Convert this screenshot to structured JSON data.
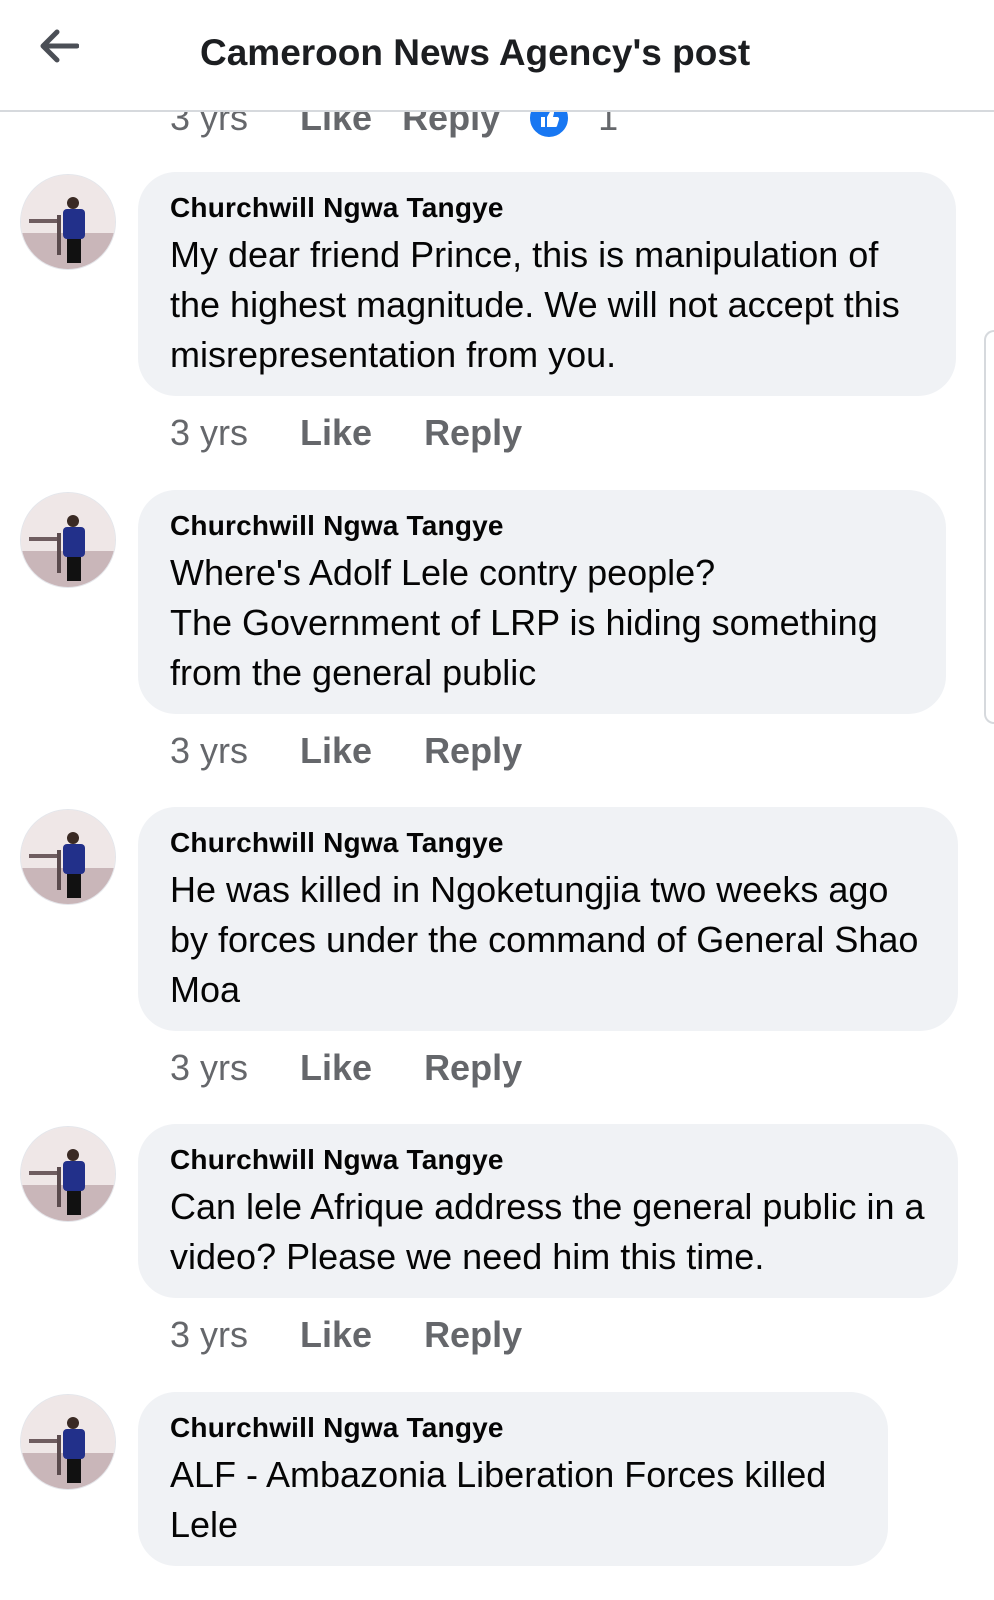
{
  "header": {
    "title": "Cameroon  News Agency's post",
    "back_icon": "arrow-left-icon"
  },
  "previous_comment_actions": {
    "time": "3 yrs",
    "like": "Like",
    "reply": "Reply",
    "reaction_icon": "like-reaction-icon",
    "reaction_count": "1"
  },
  "comments": [
    {
      "author": "Churchwill Ngwa Tangye",
      "text": "My dear friend Prince, this is manipulation of the highest magnitude. We will not accept this misrepresentation from you.",
      "time": "3 yrs",
      "like": "Like",
      "reply": "Reply"
    },
    {
      "author": "Churchwill Ngwa Tangye",
      "text": "Where's  Adolf Lele contry people?\nThe Government of LRP is hiding something from the general public",
      "time": "3 yrs",
      "like": "Like",
      "reply": "Reply"
    },
    {
      "author": "Churchwill Ngwa Tangye",
      "text": "He was killed in Ngoketungjia two weeks ago by forces under the command of General Shao Moa",
      "time": "3 yrs",
      "like": "Like",
      "reply": "Reply"
    },
    {
      "author": "Churchwill Ngwa Tangye",
      "text": "Can lele Afrique address the general public in a video? Please we need him this time.",
      "time": "3 yrs",
      "like": "Like",
      "reply": "Reply"
    },
    {
      "author": "Churchwill Ngwa Tangye",
      "text": "ALF - Ambazonia Liberation Forces killed Lele",
      "time": "",
      "like": "",
      "reply": ""
    }
  ],
  "colors": {
    "bubble": "#f0f2f5",
    "muted_text": "#65676b",
    "like_blue": "#1877f2"
  }
}
